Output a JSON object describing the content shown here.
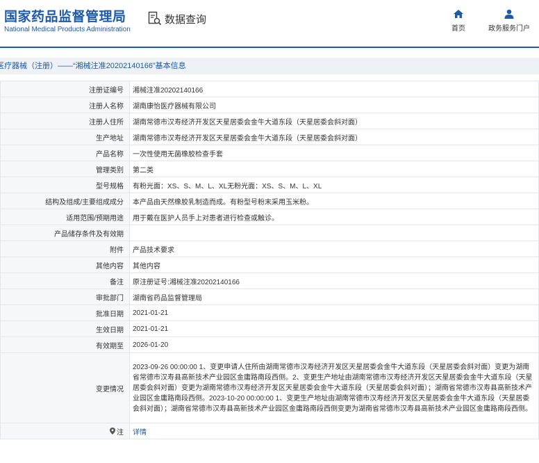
{
  "header": {
    "logo_cn": "国家药品监督管理局",
    "logo_en": "National Medical Products Administration",
    "query_label": "数据查询",
    "nav_home": "首页",
    "nav_portal": "政务服务门户"
  },
  "breadcrumb": "医疗器械（注册）——“湘械注准20202140166”基本信息",
  "rows": [
    {
      "label": "注册证编号",
      "value": "湘械注准20202140166"
    },
    {
      "label": "注册人名称",
      "value": "湖南康怡医疗器械有限公司"
    },
    {
      "label": "注册人住所",
      "value": "湖南常德市汉寿经济开发区天星居委会金牛大道东段（天星居委会斜对面）"
    },
    {
      "label": "生产地址",
      "value": "湖南常德市汉寿经济开发区天星居委会金牛大道东段（天星居委会斜对面）"
    },
    {
      "label": "产品名称",
      "value": "一次性使用无菌橡胶检查手套"
    },
    {
      "label": "管理类别",
      "value": "第二类"
    },
    {
      "label": "型号规格",
      "value": "有粉光面：XS、S、M、L、XL无粉光面：XS、S、M、L、XL"
    },
    {
      "label": "结构及组成/主要组成成分",
      "value": "本产品由天然橡胶乳制造而成。有粉型号粉末采用玉米粉。"
    },
    {
      "label": "适用范围/预期用途",
      "value": "用于戴在医护人员手上对患者进行检查或触诊。"
    },
    {
      "label": "产品储存条件及有效期",
      "value": ""
    },
    {
      "label": "附件",
      "value": "产品技术要求"
    },
    {
      "label": "其他内容",
      "value": "其他内容"
    },
    {
      "label": "备注",
      "value": "原注册证号:湘械注准20202140166"
    },
    {
      "label": "审批部门",
      "value": "湖南省药品监督管理局"
    },
    {
      "label": "批准日期",
      "value": "2021-01-21"
    },
    {
      "label": "生效日期",
      "value": "2021-01-21"
    },
    {
      "label": "有效期至",
      "value": "2026-01-20"
    }
  ],
  "change_label": "变更情况",
  "change_text": "2023-09-26 00:00:00 1、变更申请人住所由湖南常德市汉寿经济开发区天星居委会金牛大道东段（天星居委会斜对面）变更为湖南省常德市汉寿县高新技术产业园区金庸路南段西侧。2、变更生产地址由湖南常德市汉寿经济开发区天星居委会金牛大道东段（天星居委会斜对面）变更为湖南常德市汉寿经济开发区天星居委会金牛大道东段（天星居委会斜对面）；湖南省常德市汉寿县高新技术产业园区金庸路南段西侧。2023-10-20 00:00:00 1、变更生产地址由湖南常德市汉寿经济开发区天星居委会金牛大道东段（天星居委会斜对面）；湖南省常德市汉寿县高新技术产业园区金庸路南段西侧变更为湖南省常德市汉寿县高新技术产业园区金庸路南段西侧。",
  "note_label": "注",
  "note_link": "详情",
  "colors": {
    "brand": "#1e5aa8",
    "border": "#e3e6eb",
    "label_bg": "#f6f7f9"
  }
}
